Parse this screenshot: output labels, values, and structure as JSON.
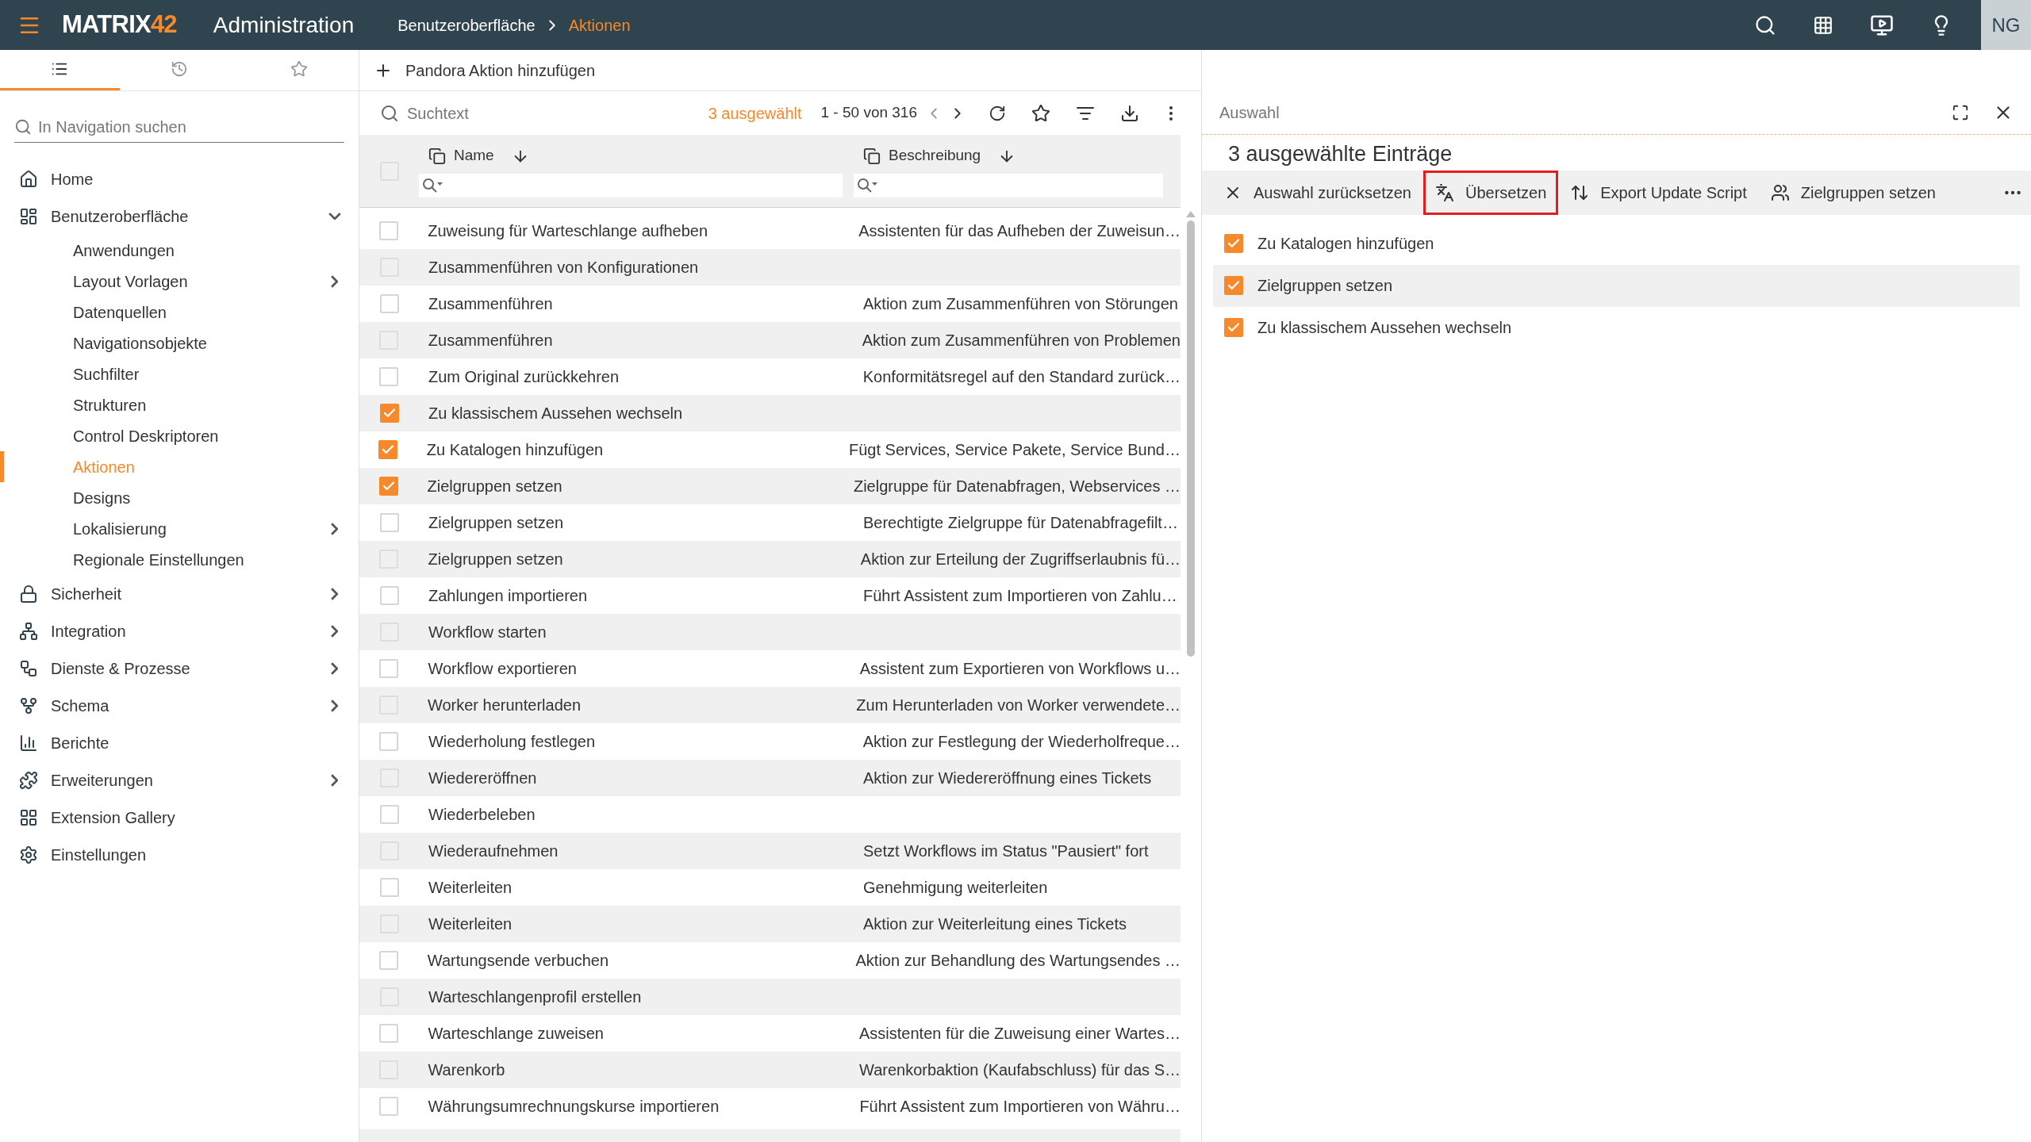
{
  "header": {
    "logo_text": "MATRIX",
    "logo_accent": "42",
    "title": "Administration",
    "breadcrumb": [
      {
        "label": "Benutzeroberfläche",
        "current": false
      },
      {
        "label": "Aktionen",
        "current": true
      }
    ],
    "user_initials": "NG"
  },
  "sidebar": {
    "tabs": [
      {
        "selected": true
      },
      {
        "selected": false
      },
      {
        "selected": false
      }
    ],
    "search": {
      "placeholder": "In Navigation suchen"
    },
    "items": [
      {
        "label": "Home",
        "has_children": false,
        "selected": false
      },
      {
        "label": "Benutzeroberfläche",
        "has_children": true,
        "expanded": true,
        "selected": false,
        "children": [
          {
            "label": "Anwendungen",
            "has_children": false,
            "selected": false
          },
          {
            "label": "Layout Vorlagen",
            "has_children": true,
            "selected": false
          },
          {
            "label": "Datenquellen",
            "has_children": false,
            "selected": false
          },
          {
            "label": "Navigationsobjekte",
            "has_children": false,
            "selected": false
          },
          {
            "label": "Suchfilter",
            "has_children": false,
            "selected": false
          },
          {
            "label": "Strukturen",
            "has_children": false,
            "selected": false
          },
          {
            "label": "Control Deskriptoren",
            "has_children": false,
            "selected": false
          },
          {
            "label": "Aktionen",
            "has_children": false,
            "selected": true
          },
          {
            "label": "Designs",
            "has_children": false,
            "selected": false
          },
          {
            "label": "Lokalisierung",
            "has_children": true,
            "selected": false
          },
          {
            "label": "Regionale Einstellungen",
            "has_children": false,
            "selected": false
          }
        ]
      },
      {
        "label": "Sicherheit",
        "has_children": true,
        "expanded": false,
        "selected": false
      },
      {
        "label": "Integration",
        "has_children": true,
        "expanded": false,
        "selected": false
      },
      {
        "label": "Dienste & Prozesse",
        "has_children": true,
        "expanded": false,
        "selected": false
      },
      {
        "label": "Schema",
        "has_children": true,
        "expanded": false,
        "selected": false
      },
      {
        "label": "Berichte",
        "has_children": false,
        "selected": false
      },
      {
        "label": "Erweiterungen",
        "has_children": true,
        "expanded": false,
        "selected": false
      },
      {
        "label": "Extension Gallery",
        "has_children": false,
        "selected": false
      },
      {
        "label": "Einstellungen",
        "has_children": false,
        "selected": false
      }
    ]
  },
  "toolbar": {
    "add_button": "Pandora Aktion hinzufügen"
  },
  "table": {
    "select_all_checked": false,
    "search": {
      "placeholder": "Suchtext"
    },
    "selection_count": "3 ausgewählt",
    "paging": "1 - 50 von 316",
    "columns": [
      {
        "label": "Name"
      },
      {
        "label": "Beschreibung"
      }
    ],
    "rows": [
      {
        "name": "Zuweisung für Warteschlange aufheben",
        "description": "Assistenten für das Aufheben der Zuweisun…",
        "checked": false
      },
      {
        "name": "Zusammenführen von Konfigurationen",
        "checked": false
      },
      {
        "name": "Zusammenführen",
        "description": "Aktion zum Zusammenführen von Störungen",
        "checked": false
      },
      {
        "name": "Zusammenführen",
        "description": "Aktion zum Zusammenführen von Problemen",
        "checked": false
      },
      {
        "name": "Zum Original zurückkehren",
        "description": "Konformitätsregel auf den Standard zurück…",
        "checked": false
      },
      {
        "name": "Zu klassischem Aussehen wechseln",
        "checked": true
      },
      {
        "name": "Zu Katalogen hinzufügen",
        "description": "Fügt Services, Service Pakete, Service Bund…",
        "checked": true
      },
      {
        "name": "Zielgruppen setzen",
        "description": "Zielgruppe für Datenabfragen, Webservices …",
        "checked": true
      },
      {
        "name": "Zielgruppen setzen",
        "description": "Berechtigte Zielgruppe für Datenabfragefilt…",
        "checked": false
      },
      {
        "name": "Zielgruppen setzen",
        "description": "Aktion zur Erteilung der Zugriffserlaubnis fü…",
        "checked": false
      },
      {
        "name": "Zahlungen importieren",
        "description": "Führt Assistent zum Importieren von Zahlu…",
        "checked": false
      },
      {
        "name": "Workflow starten",
        "checked": false
      },
      {
        "name": "Workflow exportieren",
        "description": "Assistent zum Exportieren von Workflows u…",
        "checked": false
      },
      {
        "name": "Worker herunterladen",
        "description": "Zum Herunterladen von Worker verwendete…",
        "checked": false
      },
      {
        "name": "Wiederholung festlegen",
        "description": "Aktion zur Festlegung der Wiederholfreque…",
        "checked": false
      },
      {
        "name": "Wiedereröffnen",
        "description": "Aktion zur Wiedereröffnung eines Tickets",
        "checked": false
      },
      {
        "name": "Wiederbeleben",
        "checked": false
      },
      {
        "name": "Wiederaufnehmen",
        "description": "Setzt Workflows im Status \"Pausiert\" fort",
        "checked": false
      },
      {
        "name": "Weiterleiten",
        "description": "Genehmigung weiterleiten",
        "checked": false
      },
      {
        "name": "Weiterleiten",
        "description": "Aktion zur Weiterleitung eines Tickets",
        "checked": false
      },
      {
        "name": "Wartungsende verbuchen",
        "description": "Aktion zur Behandlung des Wartungsendes …",
        "checked": false
      },
      {
        "name": "Warteschlangenprofil erstellen",
        "checked": false
      },
      {
        "name": "Warteschlange zuweisen",
        "description": "Assistenten für die Zuweisung einer Wartes…",
        "checked": false
      },
      {
        "name": "Warenkorb",
        "description": "Warenkorbaktion (Kaufabschluss) für das S…",
        "checked": false
      },
      {
        "name": "Währungsumrechnungskurse importieren",
        "description": "Führt Assistent zum Importieren von Währu…",
        "checked": false
      }
    ]
  },
  "selection_panel": {
    "title": "Auswahl",
    "heading": "3 ausgewählte Einträge",
    "actions": [
      {
        "label": "Auswahl zurücksetzen",
        "highlighted": false
      },
      {
        "label": "Übersetzen",
        "highlighted": true
      },
      {
        "label": "Export Update Script",
        "highlighted": false
      },
      {
        "label": "Zielgruppen setzen",
        "highlighted": false
      }
    ],
    "items": [
      {
        "label": "Zu Katalogen hinzufügen",
        "checked": true,
        "highlighted": false
      },
      {
        "label": "Zielgruppen setzen",
        "checked": true,
        "highlighted": true
      },
      {
        "label": "Zu klassischem Aussehen wechseln",
        "checked": true,
        "highlighted": false
      }
    ]
  }
}
